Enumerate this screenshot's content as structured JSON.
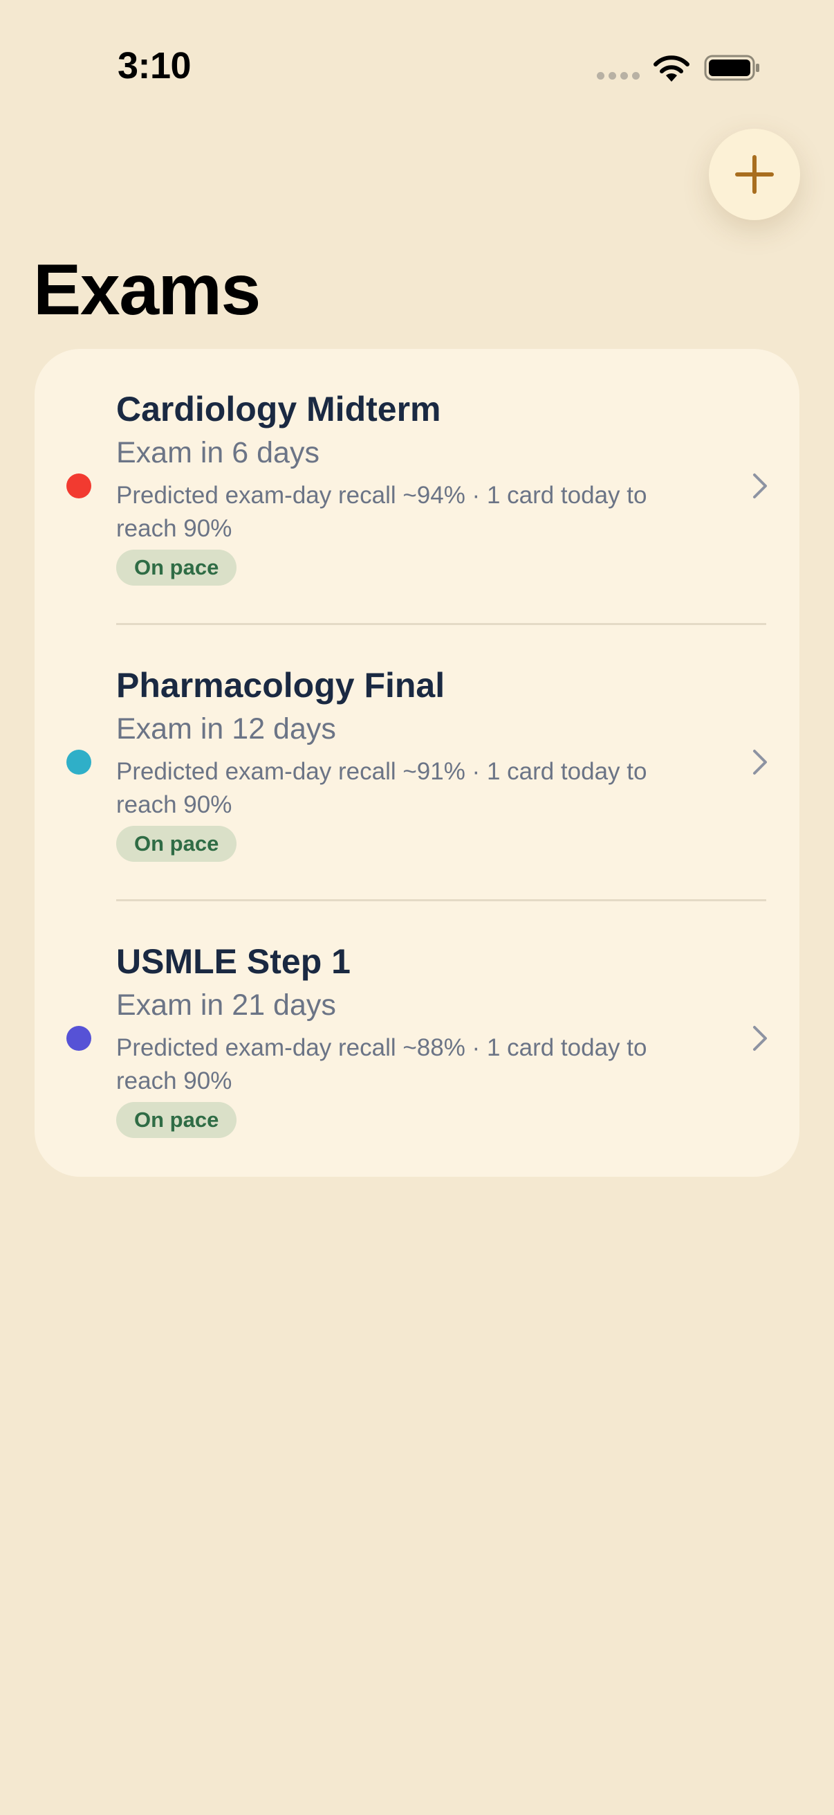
{
  "status_bar": {
    "time": "3:10",
    "icons": [
      "cellular-signal-icon",
      "wifi-icon",
      "battery-icon"
    ]
  },
  "header": {
    "add_button_icon": "plus-icon",
    "title": "Exams"
  },
  "colors": {
    "background": "#F4E8D0",
    "card": "#FCF3E1",
    "accent": "#A86E1F",
    "badge_bg": "#DAE0C8",
    "badge_text": "#2F6C45"
  },
  "exams": [
    {
      "title": "Cardiology Midterm",
      "countdown": "Exam in 6 days",
      "detail": "Predicted exam-day recall ~94% · 1 card today to reach 90%",
      "status": "On pace",
      "color": "#F23A30"
    },
    {
      "title": "Pharmacology Final",
      "countdown": "Exam in 12 days",
      "detail": "Predicted exam-day recall ~91% · 1 card today to reach 90%",
      "status": "On pace",
      "color": "#2FAFC8"
    },
    {
      "title": "USMLE Step 1",
      "countdown": "Exam in 21 days",
      "detail": "Predicted exam-day recall ~88% · 1 card today to reach 90%",
      "status": "On pace",
      "color": "#5652D6"
    }
  ]
}
